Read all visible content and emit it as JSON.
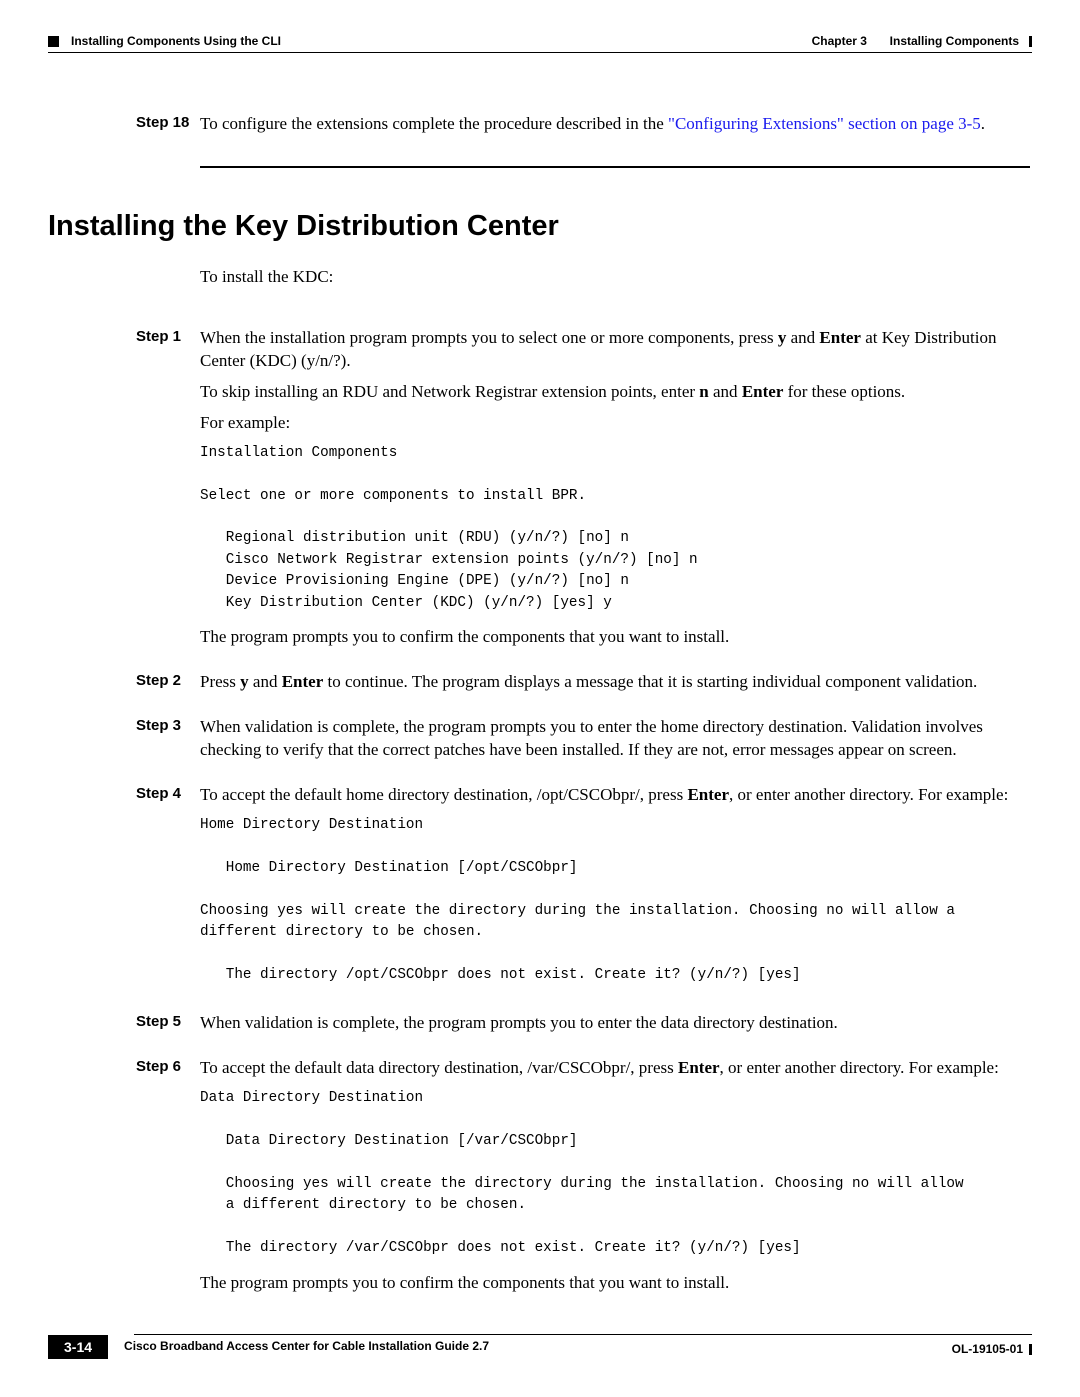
{
  "header": {
    "left": "Installing Components Using the CLI",
    "chapter": "Chapter 3",
    "chapterTitle": "Installing Components"
  },
  "step18": {
    "label": "Step 18",
    "textBefore": "To configure the extensions complete the procedure described in the ",
    "linkText": "\"Configuring Extensions\" section on page 3-5",
    "textAfter": "."
  },
  "sectionTitle": "Installing the Key Distribution Center",
  "intro": "To install the KDC:",
  "steps": [
    {
      "label": "Step 1",
      "p1a": "When the installation program prompts you to select one or more components, press ",
      "p1b": " and ",
      "p1c": " at Key Distribution Center (KDC) (y/n/?).",
      "b1": "y",
      "b2": "Enter",
      "p2a": "To skip installing an RDU and Network Registrar extension points, enter ",
      "p2b": " and ",
      "p2c": " for these options.",
      "b3": "n",
      "b4": "Enter",
      "p3": "For example:",
      "console": "Installation Components\n\nSelect one or more components to install BPR.\n\n   Regional distribution unit (RDU) (y/n/?) [no] n\n   Cisco Network Registrar extension points (y/n/?) [no] n\n   Device Provisioning Engine (DPE) (y/n/?) [no] n\n   Key Distribution Center (KDC) (y/n/?) [yes] y",
      "p4": "The program prompts you to confirm the components that you want to install."
    },
    {
      "label": "Step 2",
      "p1a": "Press ",
      "p1b": " and ",
      "p1c": " to continue. The program displays a message that it is starting individual component validation.",
      "b1": "y",
      "b2": "Enter"
    },
    {
      "label": "Step 3",
      "p1": "When validation is complete, the program prompts you to enter the home directory destination. Validation involves checking to verify that the correct patches have been installed. If they are not, error messages appear on screen."
    },
    {
      "label": "Step 4",
      "p1a": "To accept the default home directory destination, /opt/CSCObpr/, press ",
      "p1b": ", or enter another directory. For example:",
      "b1": "Enter",
      "console": "Home Directory Destination\n\n   Home Directory Destination [/opt/CSCObpr]\n\nChoosing yes will create the directory during the installation. Choosing no will allow a\ndifferent directory to be chosen.\n\n   The directory /opt/CSCObpr does not exist. Create it? (y/n/?) [yes]"
    },
    {
      "label": "Step 5",
      "p1": "When validation is complete, the program prompts you to enter the data directory destination."
    },
    {
      "label": "Step 6",
      "p1a": "To accept the default data directory destination, /var/CSCObpr/, press ",
      "p1b": ", or enter another directory. For example:",
      "b1": "Enter",
      "console": "Data Directory Destination\n\n   Data Directory Destination [/var/CSCObpr]\n\n   Choosing yes will create the directory during the installation. Choosing no will allow\n   a different directory to be chosen.\n\n   The directory /var/CSCObpr does not exist. Create it? (y/n/?) [yes]",
      "p2": "The program prompts you to confirm the components that you want to install."
    }
  ],
  "footer": {
    "title": "Cisco Broadband Access Center for Cable Installation Guide 2.7",
    "page": "3-14",
    "doc": "OL-19105-01"
  }
}
